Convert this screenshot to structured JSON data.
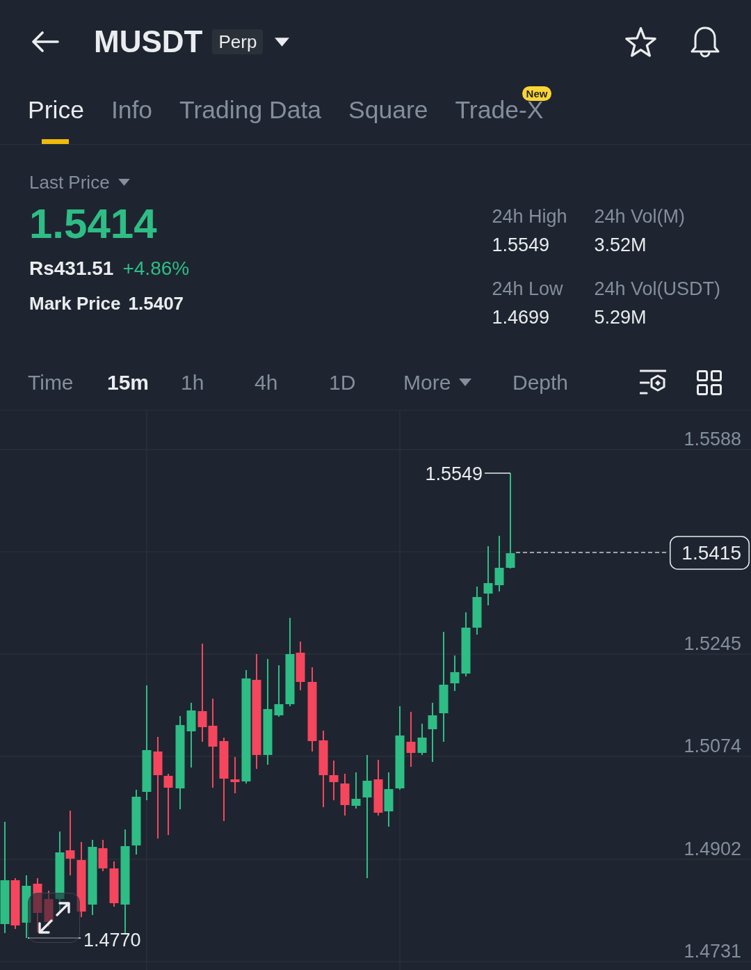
{
  "header": {
    "symbol": "MUSDT",
    "contract_badge": "Perp"
  },
  "tabs": [
    {
      "label": "Price",
      "selected": true
    },
    {
      "label": "Info",
      "selected": false
    },
    {
      "label": "Trading Data",
      "selected": false
    },
    {
      "label": "Square",
      "selected": false
    },
    {
      "label": "Trade-X",
      "selected": false,
      "badge": "New"
    }
  ],
  "price": {
    "selector": "Last Price",
    "last": "1.5414",
    "fiat": "Rs431.51",
    "change": "+4.86%",
    "mark_label": "Mark Price",
    "mark_value": "1.5407"
  },
  "stats": [
    {
      "label": "24h High",
      "value": "1.5549"
    },
    {
      "label": "24h Vol(M)",
      "value": "3.52M"
    },
    {
      "label": "24h Low",
      "value": "1.4699"
    },
    {
      "label": "24h Vol(USDT)",
      "value": "5.29M"
    }
  ],
  "intervals": [
    {
      "label": "Time",
      "kind": "option",
      "selected": false
    },
    {
      "label": "15m",
      "kind": "option",
      "selected": true
    },
    {
      "label": "1h",
      "kind": "option",
      "selected": false
    },
    {
      "label": "4h",
      "kind": "option",
      "selected": false
    },
    {
      "label": "1D",
      "kind": "option",
      "selected": false
    },
    {
      "label": "More",
      "kind": "menu",
      "selected": false
    },
    {
      "label": "Depth",
      "kind": "option",
      "selected": false
    }
  ],
  "chart": {
    "price_axis": [
      "1.5588",
      "1.5245",
      "1.5074",
      "1.4902",
      "1.4731"
    ],
    "high_marker": "1.5549",
    "current_price": "1.5415",
    "low_marker": "1.4770"
  }
}
